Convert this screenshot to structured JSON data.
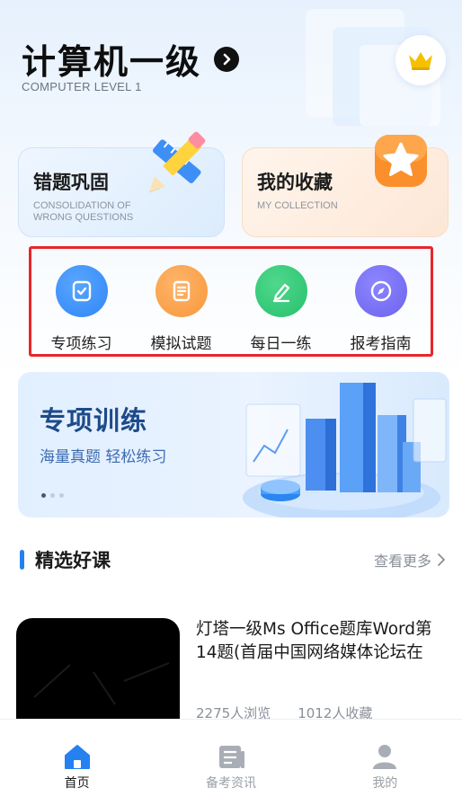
{
  "header": {
    "title": "计算机一级",
    "subtitle": "COMPUTER LEVEL 1",
    "arrow_icon": "chevron-right-icon",
    "vip_icon": "crown-icon",
    "colors": {
      "crown": "#f5c000",
      "title": "#0e0e0e"
    }
  },
  "cards": [
    {
      "title": "错题巩固",
      "en": "CONSOLIDATION OF WRONG QUESTIONS",
      "icon": "pencil-ruler-icon"
    },
    {
      "title": "我的收藏",
      "en": "MY COLLECTION",
      "icon": "star-icon"
    }
  ],
  "quick": [
    {
      "label": "专项练习",
      "icon": "checklist-icon",
      "color": "#2f86f6"
    },
    {
      "label": "模拟试题",
      "icon": "document-icon",
      "color": "#f7983b"
    },
    {
      "label": "每日一练",
      "icon": "pen-icon",
      "color": "#27c06d"
    },
    {
      "label": "报考指南",
      "icon": "compass-icon",
      "color": "#6c63ee"
    }
  ],
  "banner": {
    "title": "专项训练",
    "subtitle": "海量真题 轻松练习",
    "slides": 3,
    "active_slide": 1
  },
  "section": {
    "title": "精选好课",
    "more": "查看更多"
  },
  "course": {
    "title": "灯塔一级Ms Office题库Word第14题(首届中国网络媒体论坛在",
    "views": "2275人浏览",
    "favorites": "1012人收藏"
  },
  "tabs": [
    {
      "label": "首页",
      "icon": "home-icon",
      "active": true
    },
    {
      "label": "备考资讯",
      "icon": "news-icon",
      "active": false
    },
    {
      "label": "我的",
      "icon": "user-icon",
      "active": false
    }
  ],
  "accent": "#2580f0"
}
